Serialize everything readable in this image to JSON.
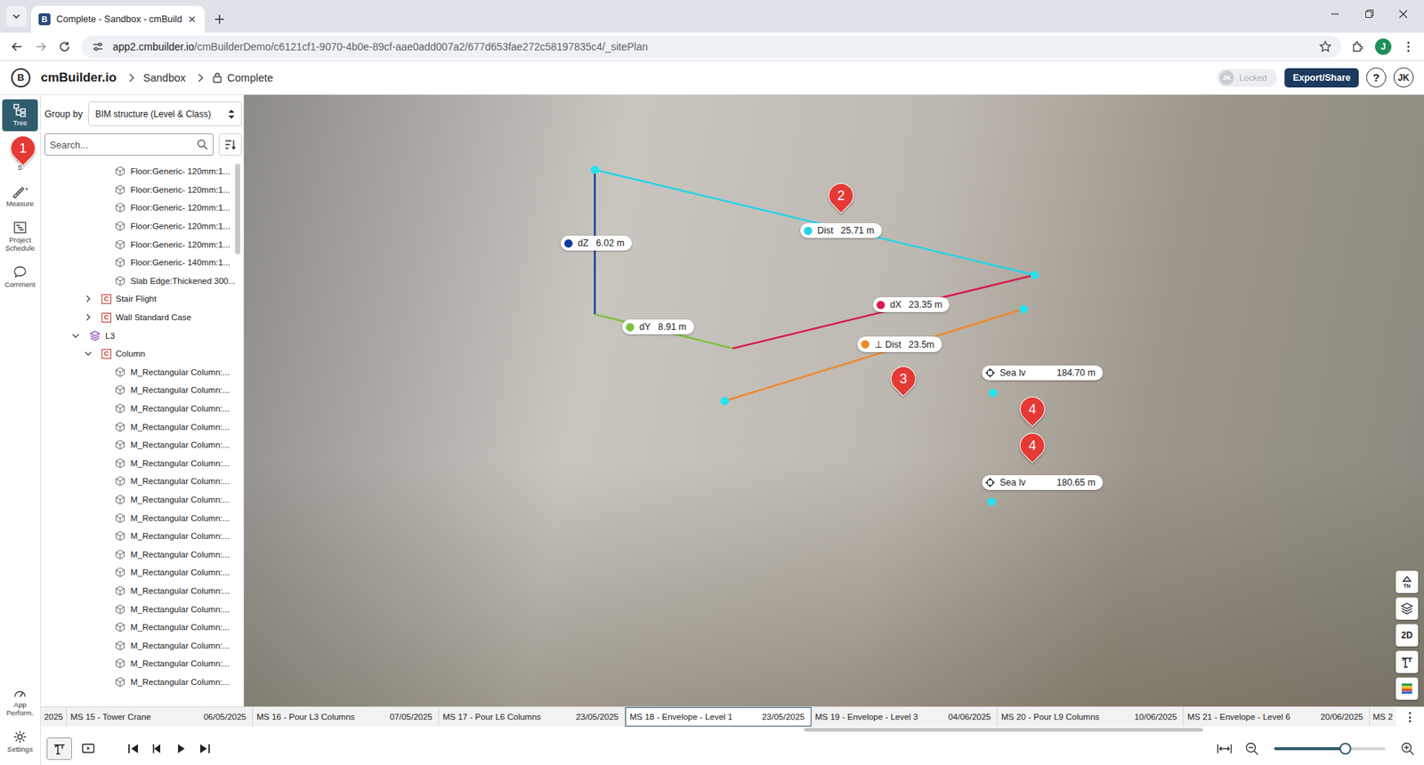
{
  "browser": {
    "tab": {
      "title": "Complete - Sandbox - cmBuild",
      "selected": true
    },
    "url": {
      "host": "app2.cmbuilder.io",
      "path": "/cmBuilderDemo/c6121cf1-9070-4b0e-89cf-aae0add007a2/677d653fae272c58197835c4/_sitePlan"
    },
    "profile": "J"
  },
  "header": {
    "logo_mark": "B",
    "brand": "cmBuilder.io",
    "breadcrumbs": [
      {
        "label": "Sandbox",
        "locked": false
      },
      {
        "label": "Complete",
        "locked": true
      }
    ],
    "lock_toggle": {
      "avatar": "JK",
      "label": "Locked",
      "disabled": true
    },
    "export_button": "Export/Share",
    "help_button": "?",
    "user": "JK"
  },
  "rail": {
    "items": [
      {
        "label": "Tree",
        "selected": true
      },
      {
        "label": "Pr\nS",
        "selected": false
      },
      {
        "label": "Measure",
        "selected": false
      },
      {
        "label": "Project Schedule",
        "selected": false
      },
      {
        "label": "Comment",
        "selected": false
      }
    ],
    "bottom_items": [
      {
        "label": "App Perform.",
        "selected": false
      },
      {
        "label": "Settings",
        "selected": false
      }
    ]
  },
  "tree": {
    "group_by_label": "Group by",
    "group_by_value": "BIM structure (Level & Class)",
    "search_placeholder": "Search...",
    "rows": [
      {
        "kind": "element",
        "label": "Floor:Generic- 120mm:1..."
      },
      {
        "kind": "element",
        "label": "Floor:Generic- 120mm:1..."
      },
      {
        "kind": "element",
        "label": "Floor:Generic- 120mm:1..."
      },
      {
        "kind": "element",
        "label": "Floor:Generic- 120mm:1..."
      },
      {
        "kind": "element",
        "label": "Floor:Generic- 120mm:1..."
      },
      {
        "kind": "element",
        "label": "Floor:Generic- 140mm:1..."
      },
      {
        "kind": "element",
        "label": "Slab Edge:Thickened 300..."
      },
      {
        "kind": "class",
        "badge": "C",
        "label": "Stair Flight",
        "expanded": false
      },
      {
        "kind": "class",
        "badge": "C",
        "label": "Wall Standard Case",
        "expanded": false
      },
      {
        "kind": "level",
        "label": "L3",
        "expanded": true
      },
      {
        "kind": "class",
        "badge": "C",
        "label": "Column",
        "expanded": true
      },
      {
        "kind": "element",
        "label": "M_Rectangular Column:..."
      },
      {
        "kind": "element",
        "label": "M_Rectangular Column:..."
      },
      {
        "kind": "element",
        "label": "M_Rectangular Column:..."
      },
      {
        "kind": "element",
        "label": "M_Rectangular Column:..."
      },
      {
        "kind": "element",
        "label": "M_Rectangular Column:..."
      },
      {
        "kind": "element",
        "label": "M_Rectangular Column:..."
      },
      {
        "kind": "element",
        "label": "M_Rectangular Column:..."
      },
      {
        "kind": "element",
        "label": "M_Rectangular Column:..."
      },
      {
        "kind": "element",
        "label": "M_Rectangular Column:..."
      },
      {
        "kind": "element",
        "label": "M_Rectangular Column:..."
      },
      {
        "kind": "element",
        "label": "M_Rectangular Column:..."
      },
      {
        "kind": "element",
        "label": "M_Rectangular Column:..."
      },
      {
        "kind": "element",
        "label": "M_Rectangular Column:..."
      },
      {
        "kind": "element",
        "label": "M_Rectangular Column:..."
      },
      {
        "kind": "element",
        "label": "M_Rectangular Column:..."
      },
      {
        "kind": "element",
        "label": "M_Rectangular Column:..."
      },
      {
        "kind": "element",
        "label": "M_Rectangular Column:..."
      },
      {
        "kind": "element",
        "label": "M_Rectangular Column:..."
      }
    ]
  },
  "measurements": [
    {
      "kind": "axis",
      "label": "dZ",
      "value": "6.02 m",
      "color": "#0d3b9e"
    },
    {
      "kind": "distance",
      "label": "Dist",
      "value": "25.71 m",
      "color": "#27d3e6"
    },
    {
      "kind": "axis",
      "label": "dY",
      "value": "8.91 m",
      "color": "#7cc242"
    },
    {
      "kind": "axis",
      "label": "dX",
      "value": "23.35 m",
      "color": "#d81b4f"
    },
    {
      "kind": "perpendicular",
      "label": "⊥ Dist",
      "value": "23.5m",
      "color": "#f0892b"
    },
    {
      "kind": "elevation",
      "label": "Sea lv",
      "value": "184.70 m"
    },
    {
      "kind": "elevation",
      "label": "Sea lv",
      "value": "180.65 m"
    }
  ],
  "markers": [
    {
      "number": "1"
    },
    {
      "number": "2"
    },
    {
      "number": "3"
    },
    {
      "number": "4"
    },
    {
      "number": "4"
    }
  ],
  "view_tools": {
    "compass": "TN",
    "mode_toggle": "2D"
  },
  "timeline": {
    "leading_date": "2025",
    "items": [
      {
        "label": "MS 15 - Tower Crane",
        "date": "06/05/2025",
        "selected": false
      },
      {
        "label": "MS 16 - Pour L3 Columns",
        "date": "07/05/2025",
        "selected": false
      },
      {
        "label": "MS 17 - Pour L6 Columns",
        "date": "23/05/2025",
        "selected": false
      },
      {
        "label": "MS 18 - Envelope - Level 1",
        "date": "23/05/2025",
        "selected": true
      },
      {
        "label": "MS 19 - Envelope - Level 3",
        "date": "04/06/2025",
        "selected": false
      },
      {
        "label": "MS 20 - Pour L9 Columns",
        "date": "10/06/2025",
        "selected": false
      },
      {
        "label": "MS 21 - Envelope - Level 6",
        "date": "20/06/2025",
        "selected": false
      }
    ],
    "trailing_label": "MS 2",
    "more": "⋮"
  },
  "bottom_bar": {
    "modes": [
      {
        "selected": true
      },
      {
        "selected": false
      }
    ],
    "zoom": {
      "level": 0.64
    }
  }
}
